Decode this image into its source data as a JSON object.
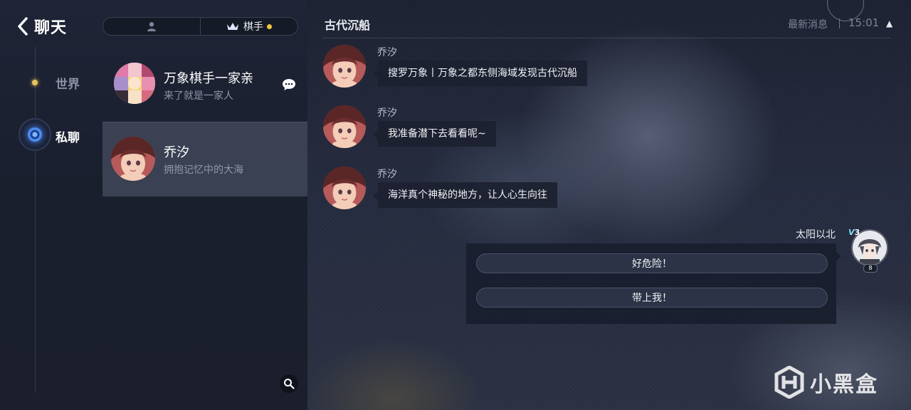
{
  "nav": {
    "back_label": "聊天",
    "world_label": "世界",
    "private_label": "私聊"
  },
  "toggle": {
    "left_icon": "person-icon",
    "right_label": "棋手",
    "right_icon": "crown-icon"
  },
  "conversations": [
    {
      "name": "万象棋手一家亲",
      "subtitle": "来了就是一家人",
      "has_chat_icon": true,
      "active": false
    },
    {
      "name": "乔汐",
      "subtitle": "拥抱记忆中的大海",
      "has_chat_icon": false,
      "active": true
    }
  ],
  "header": {
    "title": "古代沉船",
    "latest_label": "最新消息",
    "time": "15:01",
    "arrow": "▲"
  },
  "messages": [
    {
      "sender": "乔汐",
      "text": "搜罗万象丨万象之都东侧海域发现古代沉船"
    },
    {
      "sender": "乔汐",
      "text": "我准备潜下去看看呢~"
    },
    {
      "sender": "乔汐",
      "text": "海洋真个神秘的地方，让人心生向往"
    }
  ],
  "me": {
    "name": "太阳以北",
    "vip_level": "3",
    "level": "8"
  },
  "options": [
    {
      "label": "好危险！"
    },
    {
      "label": "带上我！"
    }
  ],
  "watermark": {
    "text": "小黑盒"
  },
  "colors": {
    "accent_gold": "#f0c73e",
    "panel_dark": "#1c2130",
    "active_blue": "#4b8ff0"
  }
}
